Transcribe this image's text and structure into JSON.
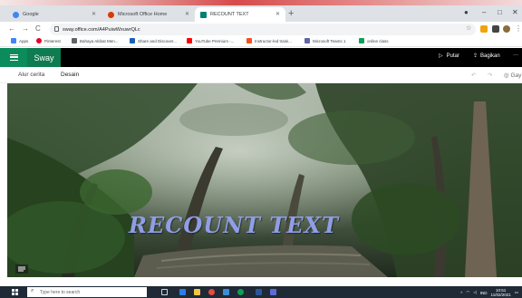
{
  "browser": {
    "tabs": [
      {
        "title": "Google",
        "active": false,
        "icon": "google-icon",
        "color": "#4285f4"
      },
      {
        "title": "Microsoft Office Home",
        "active": false,
        "icon": "office-icon",
        "color": "#d83b01"
      },
      {
        "title": "RECOUNT TEXT",
        "active": true,
        "icon": "sway-icon",
        "color": "#008272"
      }
    ],
    "new_tab": "+",
    "window_controls": [
      "–",
      "□",
      "✕"
    ],
    "nav": [
      "←",
      "→",
      "C"
    ],
    "url": "sway.office.com/A4PuiwWxuwrQLc",
    "bookmarks": [
      {
        "label": "Apps",
        "color": "#4285f4"
      },
      {
        "label": "Pinterest",
        "color": "#e60023"
      },
      {
        "label": "Bahaya Akibat Men...",
        "color": "#5f6368"
      },
      {
        "label": "Share and Discover...",
        "color": "#1a5fb4"
      },
      {
        "label": "YouTube Premium -...",
        "color": "#ff0000"
      },
      {
        "label": "Instructor-led traini...",
        "color": "#f25022"
      },
      {
        "label": "Microsoft Teams 1",
        "color": "#6264a7"
      },
      {
        "label": "online class",
        "color": "#0f9d58"
      }
    ]
  },
  "sway": {
    "brand": "Sway",
    "actions": {
      "play": "Putar",
      "share": "Bagikan",
      "more": "···"
    },
    "tabs": [
      "Alur cerita",
      "Desain"
    ],
    "active_tab": "Desain",
    "right_controls": {
      "undo": "↶",
      "redo": "↷",
      "gaya": "Gay"
    },
    "card_title": "RECOUNT TEXT",
    "accent": "#0b8c5a"
  },
  "taskbar": {
    "search_placeholder": "Type here to search",
    "tray_lang": "IND",
    "time": "10:51",
    "date": "11/02/2021"
  }
}
